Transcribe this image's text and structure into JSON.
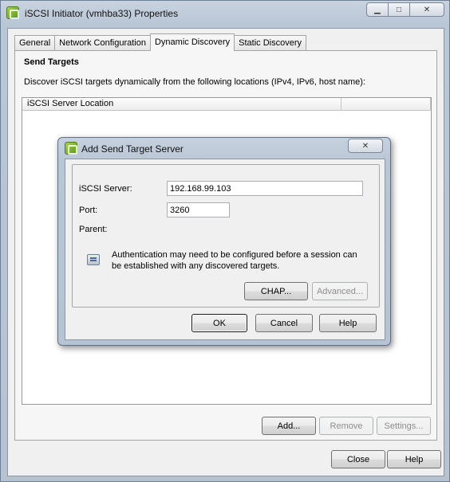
{
  "window": {
    "title": "iSCSI Initiator (vmhba33) Properties",
    "minimize_glyph": "▁",
    "maximize_glyph": "□",
    "close_glyph": "✕"
  },
  "tabs": [
    {
      "label": "General",
      "active": false
    },
    {
      "label": "Network Configuration",
      "active": false
    },
    {
      "label": "Dynamic Discovery",
      "active": true
    },
    {
      "label": "Static Discovery",
      "active": false
    }
  ],
  "send_targets": {
    "title": "Send Targets",
    "description": "Discover iSCSI targets dynamically from the following locations (IPv4, IPv6, host name):",
    "column_header": "iSCSI Server Location"
  },
  "panel_buttons": {
    "add": "Add...",
    "remove": "Remove",
    "settings": "Settings..."
  },
  "footer_buttons": {
    "close": "Close",
    "help": "Help"
  },
  "dialog": {
    "title": "Add Send Target Server",
    "close_glyph": "✕",
    "server_label": "iSCSI Server:",
    "server_value": "192.168.99.103",
    "port_label": "Port:",
    "port_value": "3260",
    "parent_label": "Parent:",
    "info_line1": "Authentication may need to be configured before a session can",
    "info_line2": "be established with any discovered targets.",
    "chap_button": "CHAP...",
    "advanced_button": "Advanced...",
    "ok_button": "OK",
    "cancel_button": "Cancel",
    "help_button": "Help"
  }
}
